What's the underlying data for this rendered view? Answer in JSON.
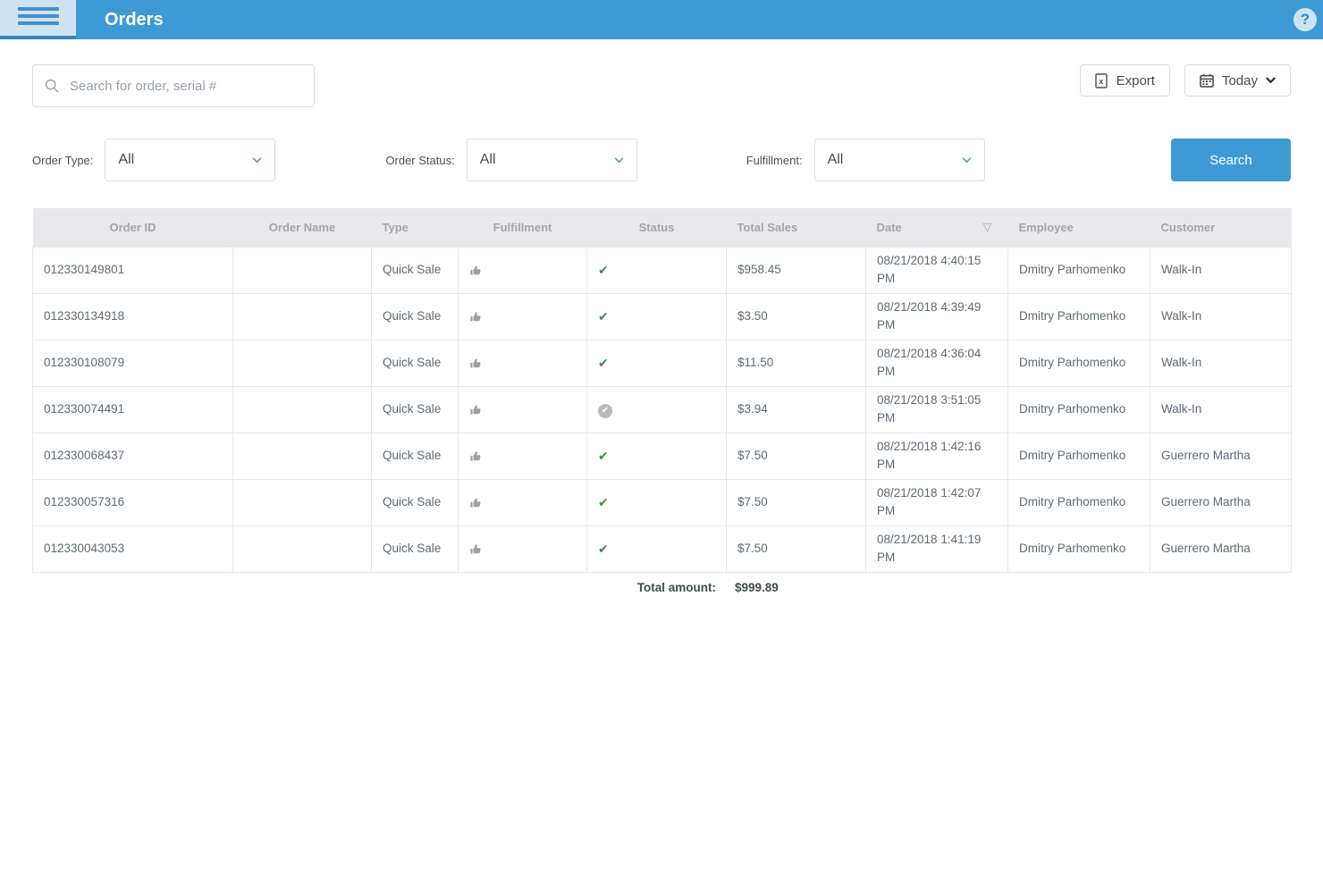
{
  "header": {
    "title": "Orders"
  },
  "icons": {
    "help_glyph": "?",
    "sort_descending": "▽",
    "check_glyph": "✔"
  },
  "toolbar": {
    "search_placeholder": "Search for order, serial #",
    "export_label": "Export",
    "date_range_label": "Today"
  },
  "filters": {
    "order_type_label": "Order Type:",
    "order_type_value": "All",
    "order_status_label": "Order Status:",
    "order_status_value": "All",
    "fulfillment_label": "Fulfillment:",
    "fulfillment_value": "All",
    "search_button_label": "Search"
  },
  "table": {
    "columns": [
      "Order ID",
      "Order Name",
      "Type",
      "Fulfillment",
      "Status",
      "Total Sales",
      "Date",
      "Employee",
      "Customer"
    ],
    "sorted_column": "Date",
    "rows": [
      {
        "order_id": "012330149801",
        "order_name": "",
        "type": "Quick Sale",
        "fulfillment": "thumbs-up",
        "status": "green-check",
        "total_sales": "$958.45",
        "date": "08/21/2018 4:40:15 PM",
        "employee": "Dmitry Parhomenko",
        "customer": "Walk-In"
      },
      {
        "order_id": "012330134918",
        "order_name": "",
        "type": "Quick Sale",
        "fulfillment": "thumbs-up",
        "status": "green-check",
        "total_sales": "$3.50",
        "date": "08/21/2018 4:39:49 PM",
        "employee": "Dmitry Parhomenko",
        "customer": "Walk-In"
      },
      {
        "order_id": "012330108079",
        "order_name": "",
        "type": "Quick Sale",
        "fulfillment": "thumbs-up",
        "status": "green-check",
        "total_sales": "$11.50",
        "date": "08/21/2018 4:36:04 PM",
        "employee": "Dmitry Parhomenko",
        "customer": "Walk-In"
      },
      {
        "order_id": "012330074491",
        "order_name": "",
        "type": "Quick Sale",
        "fulfillment": "thumbs-up",
        "status": "gray-circle-check",
        "total_sales": "$3.94",
        "date": "08/21/2018 3:51:05 PM",
        "employee": "Dmitry Parhomenko",
        "customer": "Walk-In"
      },
      {
        "order_id": "012330068437",
        "order_name": "",
        "type": "Quick Sale",
        "fulfillment": "thumbs-up",
        "status": "green-check",
        "total_sales": "$7.50",
        "date": "08/21/2018 1:42:16 PM",
        "employee": "Dmitry Parhomenko",
        "customer": "Guerrero Martha"
      },
      {
        "order_id": "012330057316",
        "order_name": "",
        "type": "Quick Sale",
        "fulfillment": "thumbs-up",
        "status": "green-check",
        "total_sales": "$7.50",
        "date": "08/21/2018 1:42:07 PM",
        "employee": "Dmitry Parhomenko",
        "customer": "Guerrero Martha"
      },
      {
        "order_id": "012330043053",
        "order_name": "",
        "type": "Quick Sale",
        "fulfillment": "thumbs-up",
        "status": "green-check",
        "total_sales": "$7.50",
        "date": "08/21/2018 1:41:19 PM",
        "employee": "Dmitry Parhomenko",
        "customer": "Guerrero Martha"
      }
    ],
    "footer": {
      "label": "Total amount:",
      "value": "$999.89"
    }
  },
  "colors": {
    "header_blue": "#3e9ad5",
    "accent_blue": "#3e9ad5",
    "success_green": "#2e9440",
    "icon_gray": "#9da0a3",
    "table_header_bg": "#e9e9ed"
  }
}
